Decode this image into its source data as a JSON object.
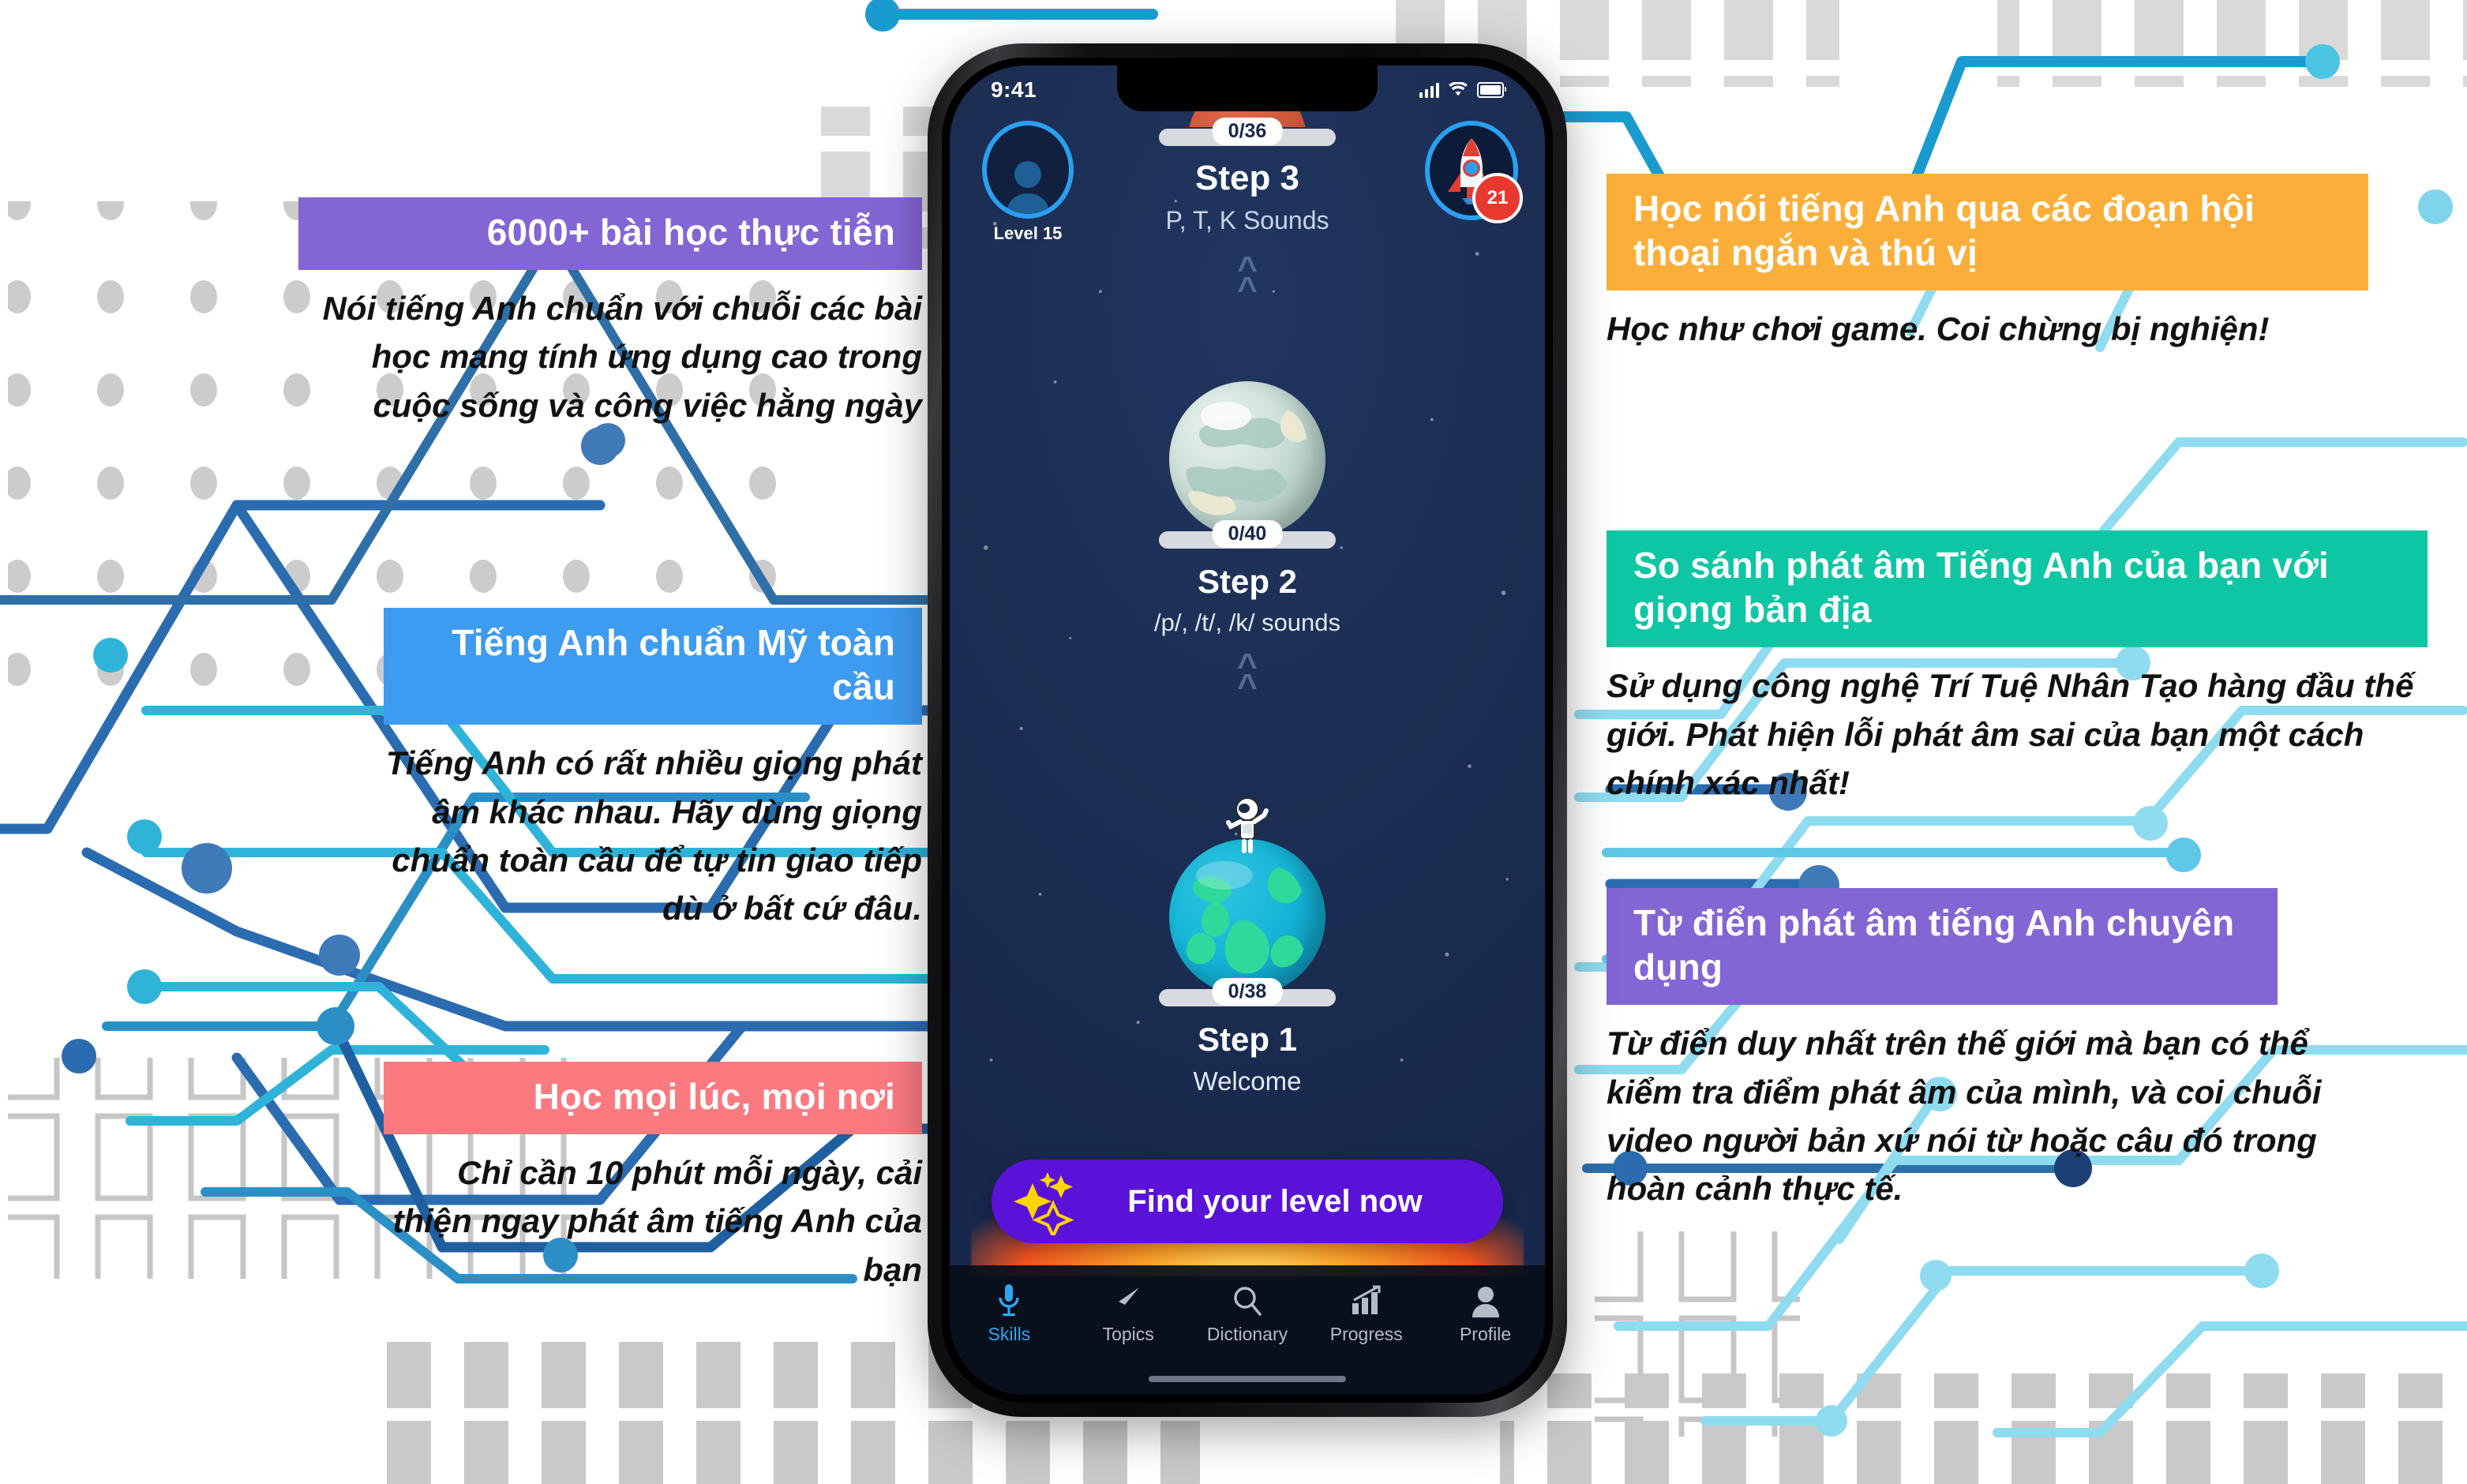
{
  "features_left": [
    {
      "id": "lessons",
      "title": "6000+ bài học thực tiễn",
      "body": "Nói tiếng Anh chuẩn với chuỗi các bài học mang tính ứng dụng cao trong cuộc sống và công việc hằng ngày",
      "color": "#8465d4"
    },
    {
      "id": "accent",
      "title": "Tiếng Anh chuẩn Mỹ toàn cầu",
      "body": "Tiếng Anh có rất nhiều giọng phát âm khác nhau. Hãy dùng giọng chuẩn toàn cầu để tự tin giao tiếp dù ở bất cứ đâu.",
      "color": "#3d9bf0"
    },
    {
      "id": "anywhere",
      "title": "Học mọi lúc, mọi nơi",
      "body": "Chỉ cần 10 phút mỗi ngày, cải thiện ngay phát âm tiếng Anh của bạn",
      "color": "#fa7a80"
    }
  ],
  "features_right": [
    {
      "id": "dialogue",
      "title": "Học nói tiếng Anh qua các đoạn hội thoại ngắn và thú vị",
      "body": "Học như chơi game. Coi chừng bị nghiện!",
      "color": "#fbaf3a"
    },
    {
      "id": "compare",
      "title": "So sánh phát âm Tiếng Anh của bạn với giọng bản địa",
      "body": "Sử dụng công nghệ Trí Tuệ Nhân Tạo hàng đầu thế giới. Phát hiện lỗi phát âm sai của bạn một cách chính xác nhất!",
      "color": "#0ec6a4"
    },
    {
      "id": "dictionary",
      "title": "Từ điển phát âm tiếng Anh chuyên dụng",
      "body": "Từ điển duy nhất trên thế giới mà bạn có thể kiểm tra điểm phát âm của mình, và coi chuỗi video người bản xứ nói từ hoặc câu đó trong hoàn cảnh thực tế.",
      "color": "#8465d4"
    }
  ],
  "phone": {
    "statusbar": {
      "time": "9:41",
      "signal_icon": "signal-bars-icon",
      "wifi_icon": "wifi-icon",
      "battery_icon": "battery-icon"
    },
    "header": {
      "avatar_icon": "user-avatar-icon",
      "level_label": "Level 15",
      "rocket_icon": "rocket-icon",
      "rocket_badge": "21"
    },
    "steps": [
      {
        "id": "step3",
        "title": "Step 3",
        "subtitle": "P, T, K Sounds",
        "progress": "0/36",
        "planet": "mars-partial"
      },
      {
        "id": "step2",
        "title": "Step 2",
        "subtitle": "/p/, /t/, /k/ sounds",
        "progress": "0/40",
        "planet": "grey-planet"
      },
      {
        "id": "step1",
        "title": "Step 1",
        "subtitle": "Welcome",
        "progress": "0/38",
        "planet": "earth-planet"
      }
    ],
    "cta": {
      "label": "Find your level now",
      "icon": "sparkle-stars-icon",
      "color": "#5b12d8"
    },
    "tabs": [
      {
        "label": "Skills",
        "icon": "microphone-icon",
        "active": true
      },
      {
        "label": "Topics",
        "icon": "paper-plane-icon",
        "active": false
      },
      {
        "label": "Dictionary",
        "icon": "search-icon",
        "active": false
      },
      {
        "label": "Progress",
        "icon": "bar-chart-icon",
        "active": false
      },
      {
        "label": "Profile",
        "icon": "person-icon",
        "active": false
      }
    ]
  },
  "colors": {
    "purple": "#8465d4",
    "blue": "#3d9bf0",
    "red": "#fa7a80",
    "orange": "#fbaf3a",
    "green": "#0ec6a4",
    "cta_purple": "#5b12d8",
    "screen_navy": "#16264a",
    "accent_cyan": "#2a9ff0"
  }
}
